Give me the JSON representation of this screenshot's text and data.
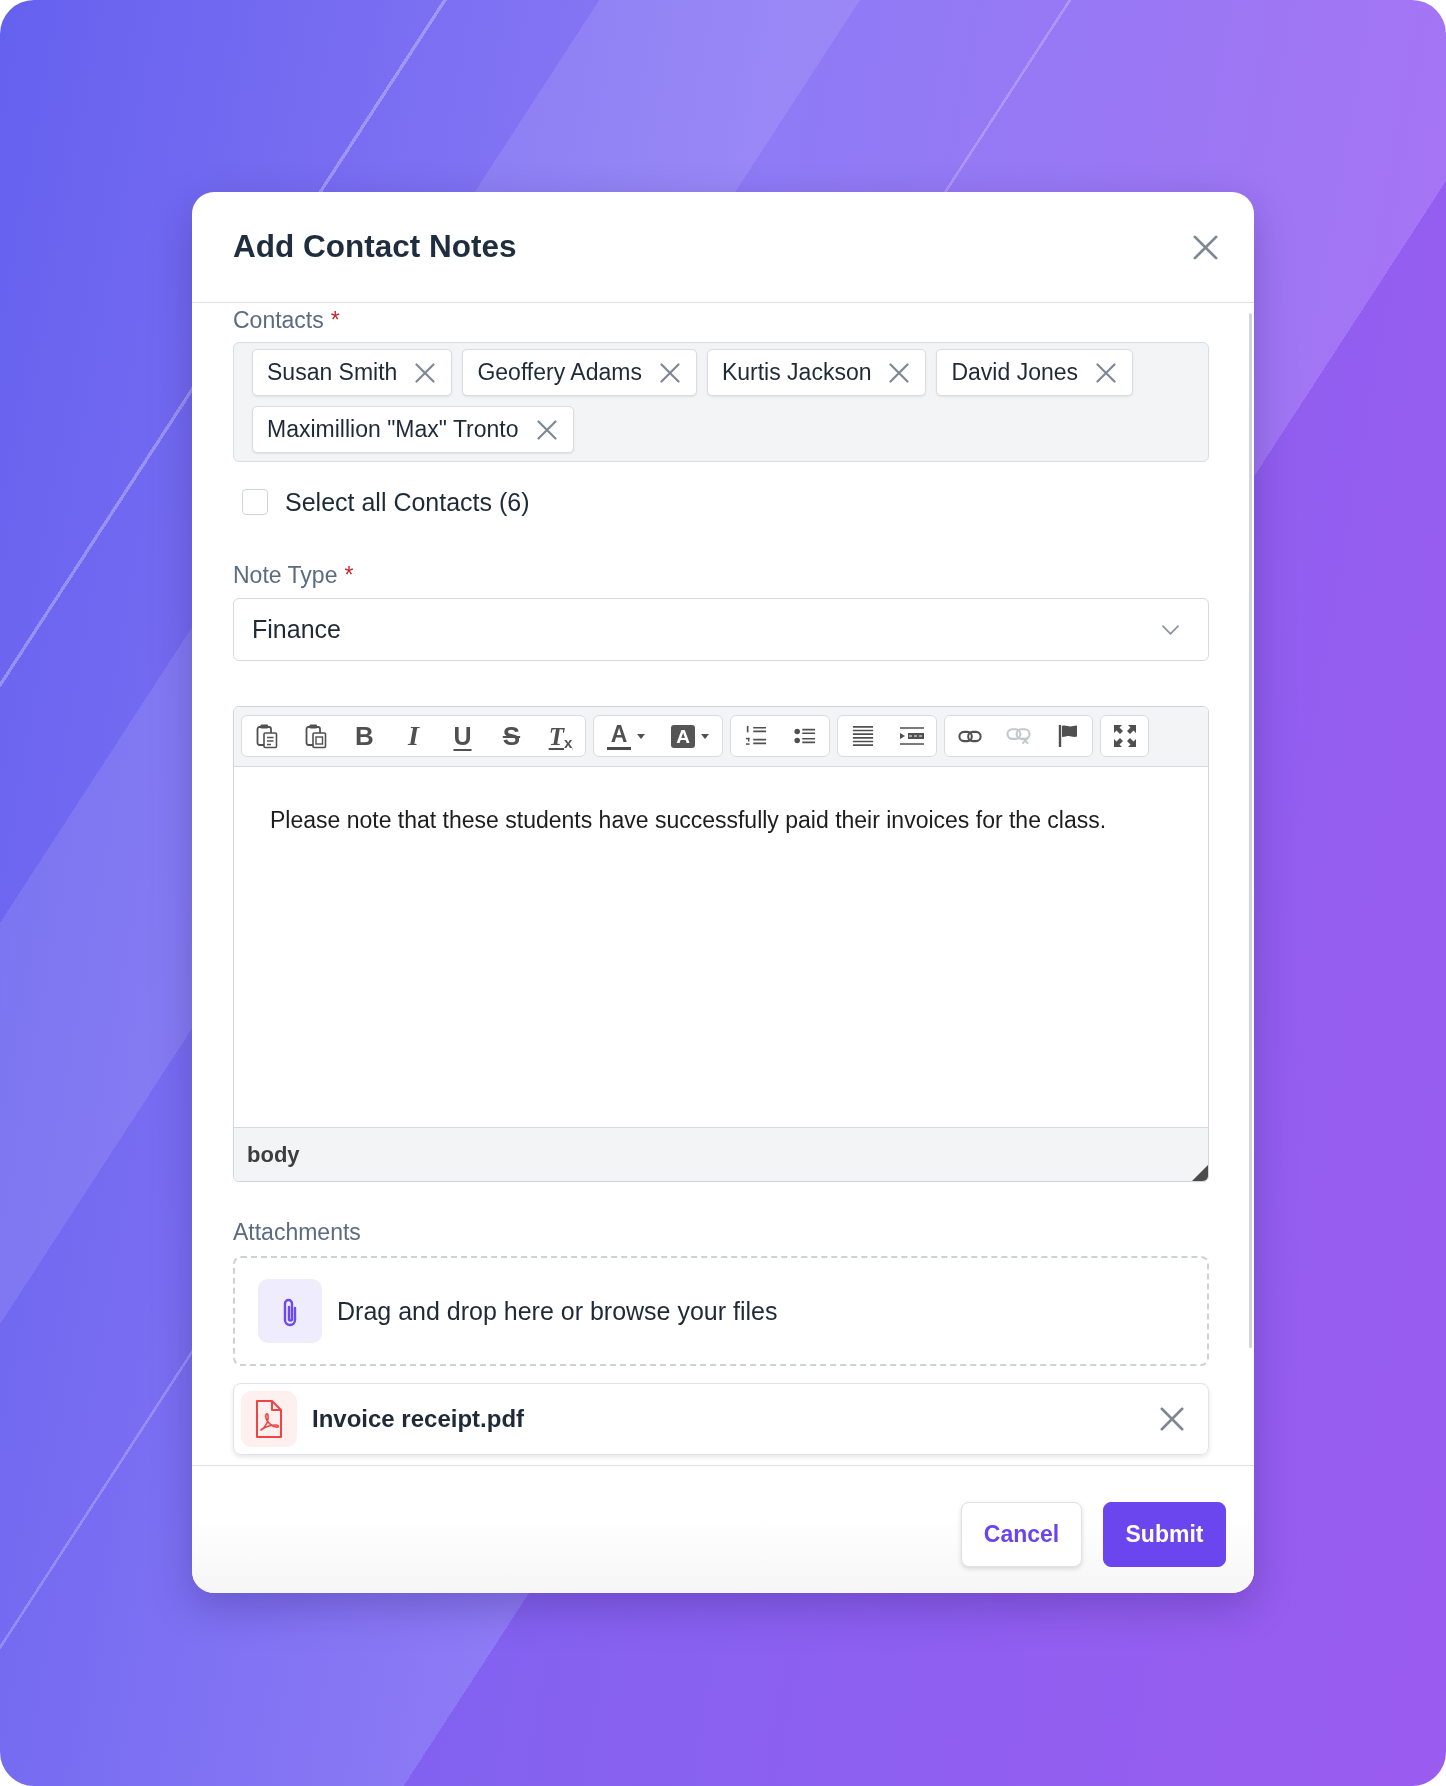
{
  "dialog": {
    "title": "Add Contact Notes"
  },
  "contacts": {
    "label": "Contacts",
    "required_mark": "*",
    "chips": [
      {
        "name": "Susan Smith"
      },
      {
        "name": "Geoffery Adams"
      },
      {
        "name": "Kurtis Jackson"
      },
      {
        "name": "David Jones"
      },
      {
        "name": "Maximillion \"Max\" Tronto"
      }
    ],
    "select_all": {
      "label": "Select all Contacts (6)",
      "checked": false
    }
  },
  "note_type": {
    "label": "Note Type",
    "required_mark": "*",
    "value": "Finance"
  },
  "editor": {
    "toolbar_groups": [
      [
        {
          "kind": "paste-text",
          "disabled": false
        },
        {
          "kind": "paste-word",
          "disabled": false
        },
        {
          "kind": "bold",
          "glyph": "B",
          "disabled": false
        },
        {
          "kind": "italic",
          "glyph": "I",
          "disabled": false
        },
        {
          "kind": "underline",
          "glyph": "U",
          "disabled": false
        },
        {
          "kind": "strike",
          "glyph": "S",
          "disabled": false
        },
        {
          "kind": "remove-format",
          "glyph": "T$_{x}$",
          "disabled": false
        }
      ],
      [
        {
          "kind": "text-color",
          "glyph": "A",
          "disabled": false
        },
        {
          "kind": "bg-color",
          "glyph": "A",
          "disabled": false
        }
      ],
      [
        {
          "kind": "numbered-list",
          "disabled": false
        },
        {
          "kind": "bulleted-list",
          "disabled": false
        }
      ],
      [
        {
          "kind": "justify",
          "disabled": false
        },
        {
          "kind": "indent",
          "disabled": false
        }
      ],
      [
        {
          "kind": "link",
          "disabled": false
        },
        {
          "kind": "unlink",
          "disabled": true
        },
        {
          "kind": "anchor",
          "disabled": false
        }
      ],
      [
        {
          "kind": "maximize",
          "disabled": false
        }
      ]
    ],
    "content": "Please note that these students have successfully paid their invoices for the class.",
    "element_path": "body"
  },
  "attachments": {
    "label": "Attachments",
    "dropzone_text": "Drag and drop here or browse your files",
    "files": [
      {
        "name": "Invoice receipt.pdf",
        "kind": "pdf"
      }
    ]
  },
  "footer": {
    "buttons": [
      {
        "label": "Cancel",
        "kind": "secondary"
      },
      {
        "label": "Submit",
        "kind": "primary"
      }
    ]
  }
}
